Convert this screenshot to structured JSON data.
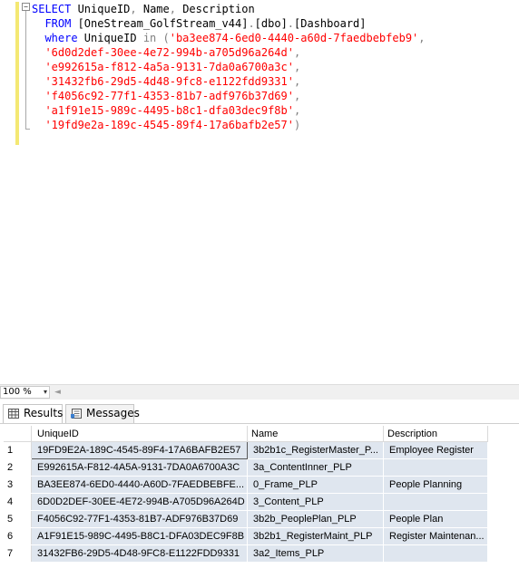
{
  "editor": {
    "collapse_glyph": "−",
    "lines": [
      [
        {
          "t": "SELECT",
          "c": "kw"
        },
        {
          "t": " UniqueID",
          "c": "ident"
        },
        {
          "t": ",",
          "c": "gray"
        },
        {
          "t": " Name",
          "c": "ident"
        },
        {
          "t": ",",
          "c": "gray"
        },
        {
          "t": " Description",
          "c": "ident"
        }
      ],
      [
        {
          "t": "  FROM",
          "c": "kw"
        },
        {
          "t": " [OneStream_GolfStream_v44]",
          "c": "ident"
        },
        {
          "t": ".",
          "c": "gray"
        },
        {
          "t": "[dbo]",
          "c": "ident"
        },
        {
          "t": ".",
          "c": "gray"
        },
        {
          "t": "[Dashboard]",
          "c": "ident"
        }
      ],
      [
        {
          "t": "  where",
          "c": "kw"
        },
        {
          "t": " UniqueID ",
          "c": "ident"
        },
        {
          "t": "in",
          "c": "gray"
        },
        {
          "t": " (",
          "c": "gray"
        },
        {
          "t": "'ba3ee874-6ed0-4440-a60d-7faedbebfeb9'",
          "c": "str"
        },
        {
          "t": ",",
          "c": "gray"
        }
      ],
      [
        {
          "t": "  '6d0d2def-30ee-4e72-994b-a705d96a264d'",
          "c": "str"
        },
        {
          "t": ",",
          "c": "gray"
        }
      ],
      [
        {
          "t": "  'e992615a-f812-4a5a-9131-7da0a6700a3c'",
          "c": "str"
        },
        {
          "t": ",",
          "c": "gray"
        }
      ],
      [
        {
          "t": "  '31432fb6-29d5-4d48-9fc8-e1122fdd9331'",
          "c": "str"
        },
        {
          "t": ",",
          "c": "gray"
        }
      ],
      [
        {
          "t": "  'f4056c92-77f1-4353-81b7-adf976b37d69'",
          "c": "str"
        },
        {
          "t": ",",
          "c": "gray"
        }
      ],
      [
        {
          "t": "  'a1f91e15-989c-4495-b8c1-dfa03dec9f8b'",
          "c": "str"
        },
        {
          "t": ",",
          "c": "gray"
        }
      ],
      [
        {
          "t": "  '19fd9e2a-189c-4545-89f4-17a6bafb2e57'",
          "c": "str"
        },
        {
          "t": ")",
          "c": "gray"
        }
      ]
    ]
  },
  "zoom": {
    "value": "100 %",
    "arrow": "▾",
    "scroll_left": "◄"
  },
  "tabs": {
    "results": "Results",
    "messages": "Messages"
  },
  "grid": {
    "columns": [
      "UniqueID",
      "Name",
      "Description"
    ],
    "rows": [
      {
        "num": "1",
        "uid": "19FD9E2A-189C-4545-89F4-17A6BAFB2E57",
        "name": "3b2b1c_RegisterMaster_P...",
        "desc": "Employee Register"
      },
      {
        "num": "2",
        "uid": "E992615A-F812-4A5A-9131-7DA0A6700A3C",
        "name": "3a_ContentInner_PLP",
        "desc": ""
      },
      {
        "num": "3",
        "uid": "BA3EE874-6ED0-4440-A60D-7FAEDBEBFE...",
        "name": "0_Frame_PLP",
        "desc": "People Planning"
      },
      {
        "num": "4",
        "uid": "6D0D2DEF-30EE-4E72-994B-A705D96A264D",
        "name": "3_Content_PLP",
        "desc": ""
      },
      {
        "num": "5",
        "uid": "F4056C92-77F1-4353-81B7-ADF976B37D69",
        "name": "3b2b_PeoplePlan_PLP",
        "desc": "People Plan"
      },
      {
        "num": "6",
        "uid": "A1F91E15-989C-4495-B8C1-DFA03DEC9F8B",
        "name": "3b2b1_RegisterMaint_PLP",
        "desc": "Register Maintenan..."
      },
      {
        "num": "7",
        "uid": "31432FB6-29D5-4D48-9FC8-E1122FDD9331",
        "name": "3a2_Items_PLP",
        "desc": ""
      }
    ]
  },
  "colors": {
    "keyword": "#0000ff",
    "string": "#ff0000",
    "punctuation": "#808080",
    "row_fill": "#dfe6ef",
    "change_bar": "#f4e873"
  }
}
